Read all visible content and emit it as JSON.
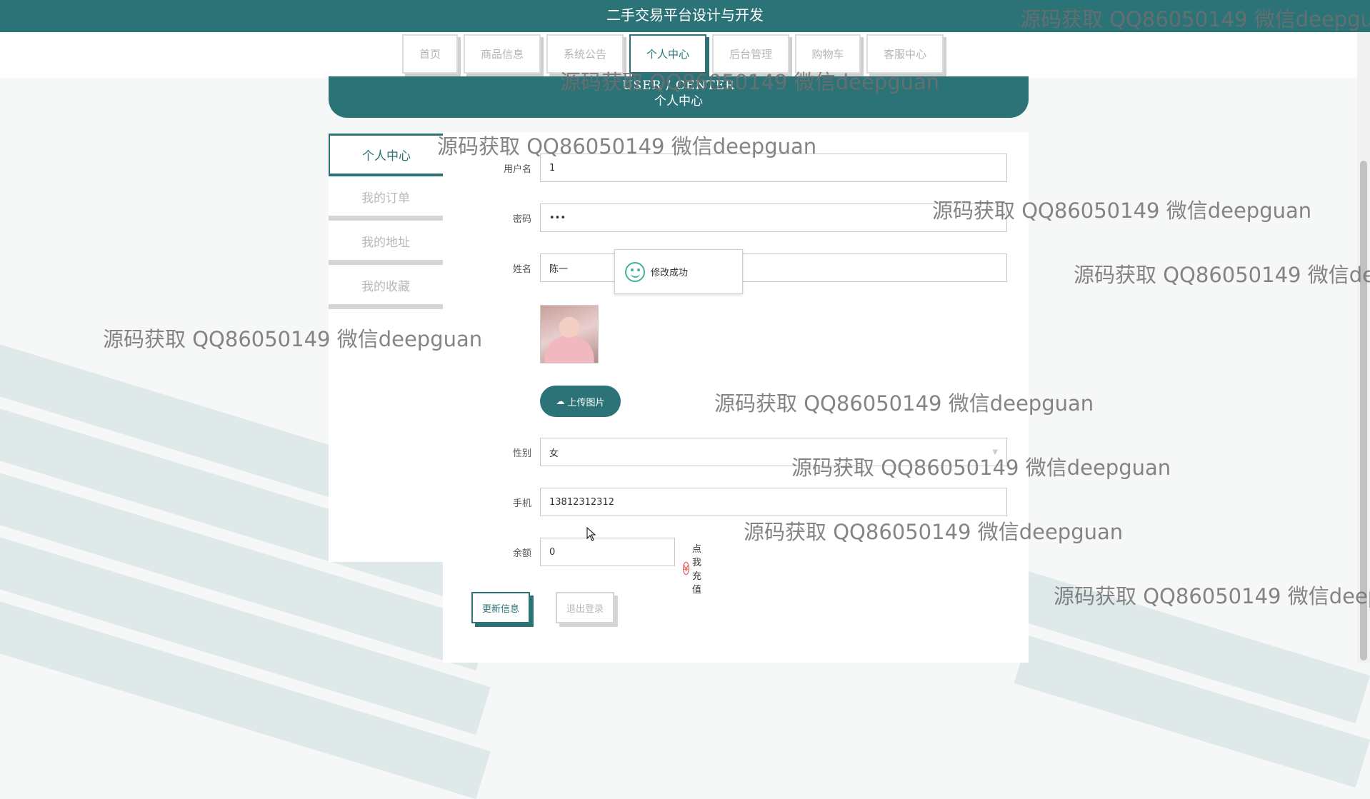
{
  "site": {
    "title": "二手交易平台设计与开发"
  },
  "nav": {
    "tabs": [
      {
        "label": "首页",
        "active": false
      },
      {
        "label": "商品信息",
        "active": false
      },
      {
        "label": "系统公告",
        "active": false
      },
      {
        "label": "个人中心",
        "active": true
      },
      {
        "label": "后台管理",
        "active": false
      },
      {
        "label": "购物车",
        "active": false
      },
      {
        "label": "客服中心",
        "active": false
      }
    ]
  },
  "banner": {
    "title_en": "USER / CENTER",
    "title_cn": "个人中心"
  },
  "sidebar": {
    "items": [
      {
        "label": "个人中心",
        "active": true
      },
      {
        "label": "我的订单",
        "active": false
      },
      {
        "label": "我的地址",
        "active": false
      },
      {
        "label": "我的收藏",
        "active": false
      }
    ]
  },
  "form": {
    "username": {
      "label": "用户名",
      "value": "1"
    },
    "password": {
      "label": "密码",
      "value": "•••"
    },
    "name": {
      "label": "姓名",
      "value": "陈一"
    },
    "upload_label": "上传图片",
    "gender": {
      "label": "性别",
      "value": "女"
    },
    "phone": {
      "label": "手机",
      "value": "13812312312"
    },
    "balance": {
      "label": "余额",
      "value": "0"
    },
    "recharge_label": "点我充值"
  },
  "actions": {
    "update_label": "更新信息",
    "logout_label": "退出登录"
  },
  "toast": {
    "message": "修改成功"
  },
  "watermark": {
    "text": "源码获取 QQ86050149 微信deepguan"
  },
  "colors": {
    "primary": "#2b7377",
    "toast_icon": "#3fb39b",
    "recharge_icon": "#e33333"
  }
}
